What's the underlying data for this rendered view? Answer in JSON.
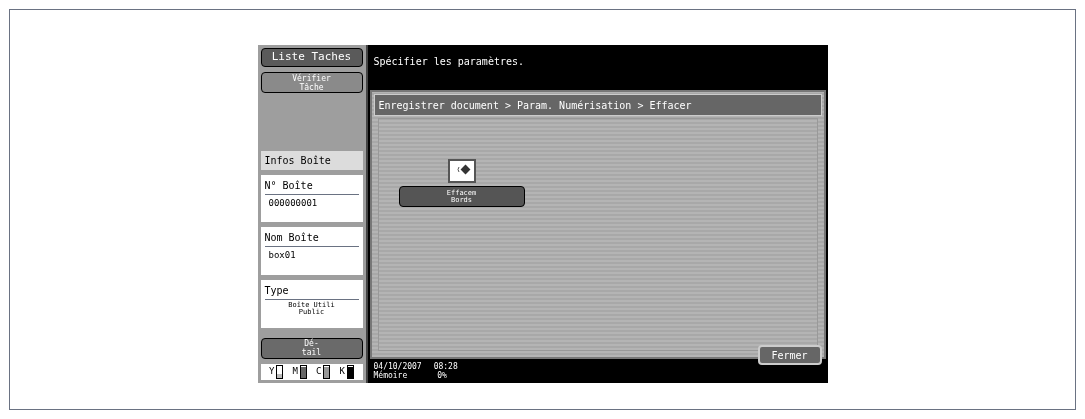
{
  "sidebar": {
    "job_list_button": "Liste Taches",
    "check_job_button": [
      "Vérifier",
      "Tâche"
    ],
    "section_title": "Infos Boîte",
    "fields": [
      {
        "label": "N° Boîte",
        "value": "000000001",
        "kind": "plain"
      },
      {
        "label": "Nom Boîte",
        "value": "box01",
        "kind": "plain"
      },
      {
        "label": "Type",
        "value": "Boîte Utili\nPublic",
        "kind": "small"
      }
    ],
    "detail_button": "Dé-\ntail",
    "toner": [
      {
        "label": "Y",
        "level": 0.3,
        "color": "#bbbbbb"
      },
      {
        "label": "M",
        "level": 0.9,
        "color": "#666666"
      },
      {
        "label": "C",
        "level": 0.9,
        "color": "#999999"
      },
      {
        "label": "K",
        "level": 0.9,
        "color": "#000000"
      }
    ]
  },
  "message": "Spécifier les paramètres.",
  "breadcrumb": "Enregistrer document > Param. Numérisation  > Effacer",
  "functions": [
    {
      "label": "Effacem\nBords"
    }
  ],
  "status_bar": {
    "date": "04/10/2007",
    "time": "08:28",
    "memory_label": "Mémoire",
    "memory_value": "0%"
  },
  "close_button": "Fermer"
}
